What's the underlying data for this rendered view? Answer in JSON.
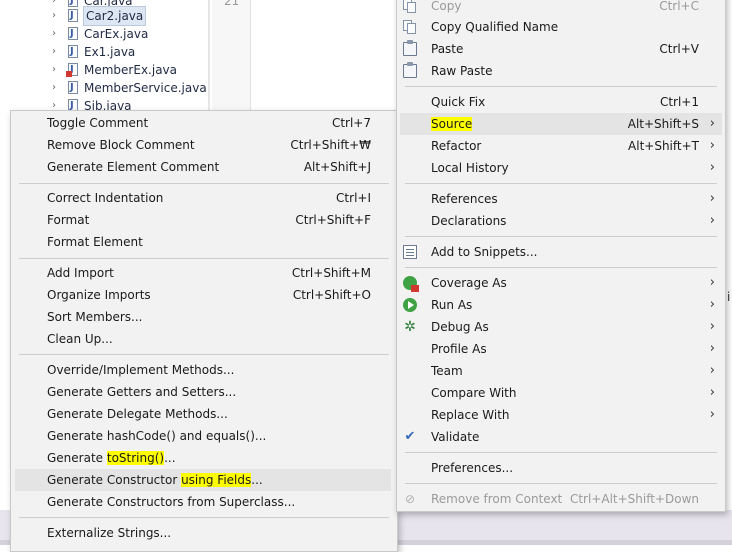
{
  "tree": {
    "items": [
      {
        "label": "Car.java",
        "error": false
      },
      {
        "label": "Car2.java",
        "error": false,
        "selected": true
      },
      {
        "label": "CarEx.java",
        "error": false
      },
      {
        "label": "Ex1.java",
        "error": false
      },
      {
        "label": "MemberEx.java",
        "error": true
      },
      {
        "label": "MemberService.java",
        "error": false
      },
      {
        "label": "Sib.java",
        "error": false
      }
    ]
  },
  "editor": {
    "line_number": "21"
  },
  "glyphs": {
    "chevron": "›",
    "submenu_arrow": "›",
    "check": "✔",
    "debug": "✲",
    "remove": "⊘",
    "far_right": "i"
  },
  "source_menu": {
    "items": [
      {
        "label": "Toggle Comment",
        "accel": "Ctrl+7"
      },
      {
        "label": "Remove Block Comment",
        "accel": "Ctrl+Shift+₩"
      },
      {
        "label": "Generate Element Comment",
        "accel": "Alt+Shift+J"
      },
      {
        "label": "Correct Indentation",
        "accel": "Ctrl+I"
      },
      {
        "label": "Format",
        "accel": "Ctrl+Shift+F"
      },
      {
        "label": "Format Element",
        "accel": ""
      },
      {
        "label": "Add Import",
        "accel": "Ctrl+Shift+M"
      },
      {
        "label": "Organize Imports",
        "accel": "Ctrl+Shift+O"
      },
      {
        "label": "Sort Members...",
        "accel": ""
      },
      {
        "label": "Clean Up...",
        "accel": ""
      },
      {
        "label": "Override/Implement Methods...",
        "accel": ""
      },
      {
        "label": "Generate Getters and Setters...",
        "accel": ""
      },
      {
        "label": "Generate Delegate Methods...",
        "accel": ""
      },
      {
        "label": "Generate hashCode() and equals()...",
        "accel": ""
      },
      {
        "label_pre": "Generate ",
        "label_hl": "toString()",
        "label_post": "...",
        "accel": ""
      },
      {
        "label_pre": "Generate Constructor ",
        "label_hl": "using Fields",
        "label_post": "...",
        "accel": ""
      },
      {
        "label": "Generate Constructors from Superclass...",
        "accel": ""
      },
      {
        "label": "Externalize Strings...",
        "accel": ""
      }
    ]
  },
  "context_menu": {
    "items": [
      {
        "label": "Copy",
        "accel": "Ctrl+C"
      },
      {
        "label": "Copy Qualified Name",
        "accel": ""
      },
      {
        "label": "Paste",
        "accel": "Ctrl+V"
      },
      {
        "label": "Raw Paste",
        "accel": ""
      },
      {
        "label": "Quick Fix",
        "accel": "Ctrl+1"
      },
      {
        "label": "Source",
        "accel": "Alt+Shift+S"
      },
      {
        "label": "Refactor",
        "accel": "Alt+Shift+T"
      },
      {
        "label": "Local History",
        "accel": ""
      },
      {
        "label": "References",
        "accel": ""
      },
      {
        "label": "Declarations",
        "accel": ""
      },
      {
        "label": "Add to Snippets...",
        "accel": ""
      },
      {
        "label": "Coverage As",
        "accel": ""
      },
      {
        "label": "Run As",
        "accel": ""
      },
      {
        "label": "Debug As",
        "accel": ""
      },
      {
        "label": "Profile As",
        "accel": ""
      },
      {
        "label": "Team",
        "accel": ""
      },
      {
        "label": "Compare With",
        "accel": ""
      },
      {
        "label": "Replace With",
        "accel": ""
      },
      {
        "label": "Validate",
        "accel": ""
      },
      {
        "label": "Preferences...",
        "accel": ""
      },
      {
        "label": "Remove from Context",
        "accel": "Ctrl+Alt+Shift+Down"
      }
    ]
  }
}
